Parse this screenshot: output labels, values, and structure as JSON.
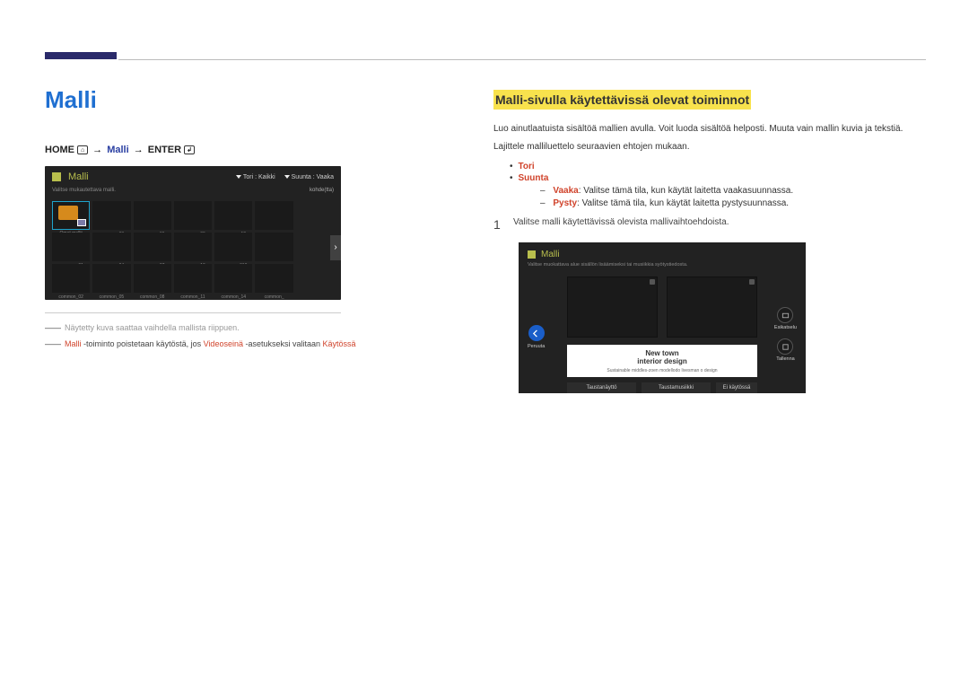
{
  "header": {
    "title": "Malli"
  },
  "breadcrumb": {
    "home": "HOME",
    "arrow": "→",
    "mid": "Malli",
    "enter": "ENTER"
  },
  "shot1": {
    "title": "Malli",
    "drop1": "Tori : Kaikki",
    "drop2": "Suunta : Vaaka",
    "subleft": "Valitse mukautettava malli.",
    "subright": "kohde(tta)",
    "selcap": "Omat mallit",
    "cells": [
      "common_03",
      "common_06",
      "common_09",
      "common_12",
      "common_",
      "common_01",
      "common_04",
      "common_07",
      "common_10",
      "common_013",
      "common_",
      "common_02",
      "common_05",
      "common_08",
      "common_11",
      "common_14",
      "common_"
    ]
  },
  "notes": {
    "dash": "――",
    "n1": "Näytetty kuva saattaa vaihdella mallista riippuen.",
    "n2a": "Malli",
    "n2b": " -toiminto poistetaan käytöstä, jos ",
    "n2c": "Videoseinä",
    "n2d": " -asetukseksi valitaan ",
    "n2e": "Käytössä"
  },
  "section": {
    "heading": "Malli-sivulla käytettävissä olevat toiminnot"
  },
  "body": {
    "p1": "Luo ainutlaatuista sisältöä mallien avulla. Voit luoda sisältöä helposti. Muuta vain mallin kuvia ja tekstiä.",
    "p2": "Lajittele malliluettelo seuraavien ehtojen mukaan."
  },
  "bullets": {
    "dot": "•",
    "b1": "Tori",
    "b2": "Suunta",
    "dash": "–",
    "s1lead": "Vaaka",
    "s1": ": Valitse tämä tila, kun käytät laitetta vaakasuunnassa.",
    "s2lead": "Pysty",
    "s2": ": Valitse tämä tila, kun käytät laitetta pystysuunnassa."
  },
  "step": {
    "num": "1",
    "text": "Valitse malli käytettävissä olevista mallivaihtoehdoista."
  },
  "shot2": {
    "title": "Malli",
    "sub": "Valitse muokattava alue sisällön lisäämiseksi tai musiikkia syötystiedosta.",
    "leftlabel": "Peruuta",
    "r1": "Esikatselu",
    "r2": "Tallenna",
    "cap1": "New town",
    "cap2": "interior design",
    "cap3": "Sustainable middles-zoen modellodo livesman o design",
    "f1": "Taustanäyttö",
    "f2": "Taustamusiikki",
    "f3": "Ei käytössä"
  }
}
